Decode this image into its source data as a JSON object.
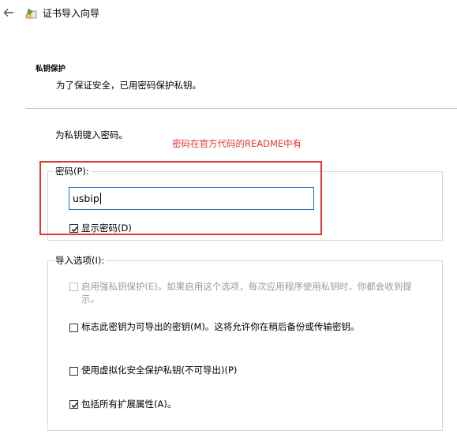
{
  "window": {
    "title": "证书导入向导",
    "icons": [
      "back-arrow-icon",
      "certificate-wizard-icon"
    ]
  },
  "section": {
    "heading": "私钥保护",
    "description": "为了保证安全，已用密码保护私钥。"
  },
  "prompt": "为私钥键入密码。",
  "annotation": "密码在官方代码的README中有",
  "colors": {
    "annotation": "#e0362f",
    "input_focus_border": "#1f6fb5"
  },
  "password": {
    "legend": "密码(P):",
    "value": "usbip",
    "show_password": {
      "label": "显示密码(D)",
      "checked": true
    }
  },
  "import_options": {
    "legend": "导入选项(I):",
    "options": [
      {
        "label_line1": "启用强私钥保护(E)。如果启用这个选项，每次应用程序使用私钥时，你都会收到提",
        "label_line2": "示。",
        "checked": false,
        "disabled": true
      },
      {
        "label": "标志此密钥为可导出的密钥(M)。这将允许你在稍后备份或传输密钥。",
        "checked": false,
        "disabled": false
      },
      {
        "label": "使用虚拟化安全保护私钥(不可导出)(P)",
        "checked": false,
        "disabled": false
      },
      {
        "label": "包括所有扩展属性(A)。",
        "checked": true,
        "disabled": false
      }
    ]
  }
}
